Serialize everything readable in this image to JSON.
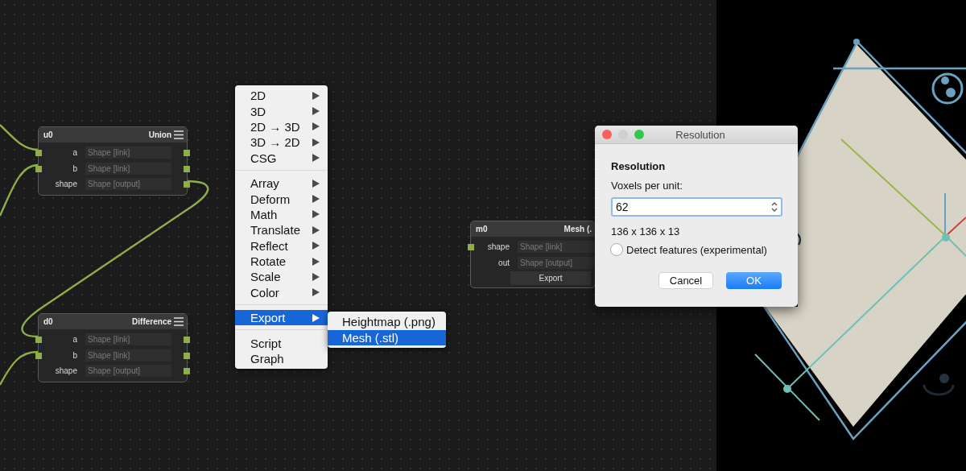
{
  "nodes": [
    {
      "name": "u0",
      "title": "Union",
      "rows": [
        {
          "label": "a",
          "placeholder": "Shape [link]",
          "input_port": true,
          "output_port": true
        },
        {
          "label": "b",
          "placeholder": "Shape [link]",
          "input_port": true,
          "output_port": true
        },
        {
          "label": "shape",
          "placeholder": "Shape [output]",
          "input_port": false,
          "output_port": true
        }
      ]
    },
    {
      "name": "d0",
      "title": "Difference",
      "rows": [
        {
          "label": "a",
          "placeholder": "Shape [link]",
          "input_port": true,
          "output_port": true
        },
        {
          "label": "b",
          "placeholder": "Shape [link]",
          "input_port": true,
          "output_port": true
        },
        {
          "label": "shape",
          "placeholder": "Shape [output]",
          "input_port": false,
          "output_port": true
        }
      ]
    },
    {
      "name": "m0",
      "title": "Mesh (.",
      "rows": [
        {
          "label": "shape",
          "placeholder": "Shape [link]",
          "input_port": true,
          "output_port": false
        },
        {
          "label": "out",
          "placeholder": "Shape [output]",
          "input_port": false,
          "output_port": false
        }
      ],
      "button": "Export"
    }
  ],
  "menu": {
    "sections": [
      {
        "items": [
          {
            "label": "2D",
            "kind": "submenu",
            "selected": false
          },
          {
            "label": "3D",
            "kind": "submenu",
            "selected": false
          },
          {
            "label": "2D → 3D",
            "kind": "submenu",
            "selected": false
          },
          {
            "label": "3D → 2D",
            "kind": "submenu",
            "selected": false
          },
          {
            "label": "CSG",
            "kind": "submenu",
            "selected": false
          }
        ]
      },
      {
        "items": [
          {
            "label": "Array",
            "kind": "submenu",
            "selected": false
          },
          {
            "label": "Deform",
            "kind": "submenu",
            "selected": false
          },
          {
            "label": "Math",
            "kind": "submenu",
            "selected": false
          },
          {
            "label": "Translate",
            "kind": "submenu",
            "selected": false
          },
          {
            "label": "Reflect",
            "kind": "submenu",
            "selected": false
          },
          {
            "label": "Rotate",
            "kind": "submenu",
            "selected": false
          },
          {
            "label": "Scale",
            "kind": "submenu",
            "selected": false
          },
          {
            "label": "Color",
            "kind": "submenu",
            "selected": false
          }
        ]
      },
      {
        "items": [
          {
            "label": "Export",
            "kind": "submenu",
            "selected": true
          }
        ]
      },
      {
        "items": [
          {
            "label": "Script",
            "kind": "plain",
            "selected": false
          },
          {
            "label": "Graph",
            "kind": "plain",
            "selected": false
          }
        ]
      }
    ],
    "submenu": [
      {
        "label": "Heightmap (.png)",
        "selected": false
      },
      {
        "label": "Mesh (.stl)",
        "selected": true
      }
    ]
  },
  "dialog": {
    "title": "Resolution",
    "heading": "Resolution",
    "field_label": "Voxels per unit:",
    "value": "62",
    "dimensions": "136 x 136 x 13",
    "checkbox": {
      "label": "Detect features (experimental)",
      "checked": false
    },
    "buttons": [
      {
        "label": "Cancel",
        "default": false
      },
      {
        "label": "OK",
        "default": true
      }
    ]
  }
}
